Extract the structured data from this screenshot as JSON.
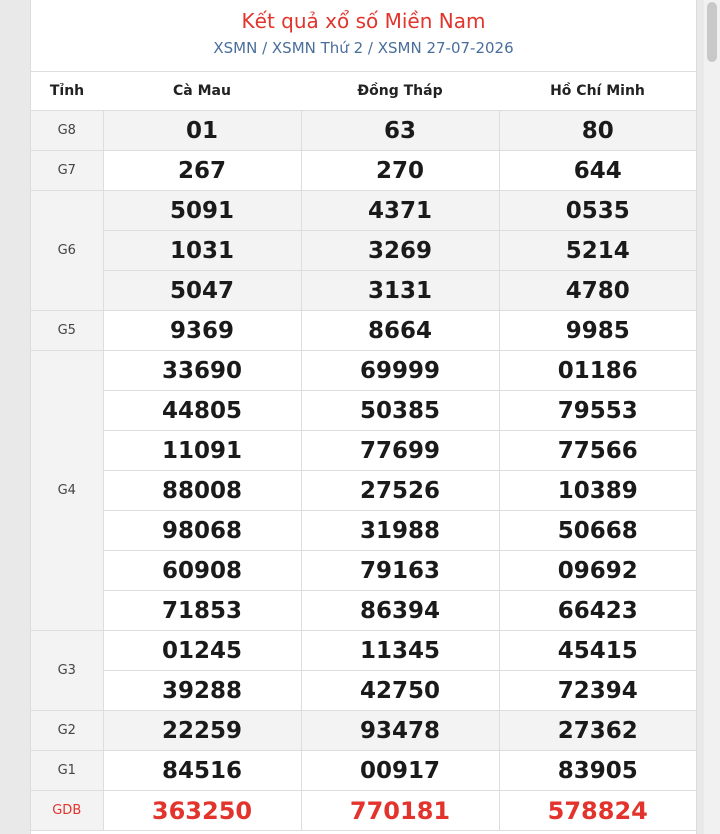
{
  "header": {
    "title": "Kết quả xổ số Miền Nam",
    "subtitle": "XSMN / XSMN Thứ 2 / XSMN 27-07-2026"
  },
  "table": {
    "columns": [
      "Tỉnh",
      "Cà Mau",
      "Đồng Tháp",
      "Hồ Chí Minh"
    ],
    "prizes": [
      {
        "label": "G8",
        "rows": [
          [
            "01",
            "63",
            "80"
          ]
        ]
      },
      {
        "label": "G7",
        "rows": [
          [
            "267",
            "270",
            "644"
          ]
        ]
      },
      {
        "label": "G6",
        "rows": [
          [
            "5091",
            "4371",
            "0535"
          ],
          [
            "1031",
            "3269",
            "5214"
          ],
          [
            "5047",
            "3131",
            "4780"
          ]
        ]
      },
      {
        "label": "G5",
        "rows": [
          [
            "9369",
            "8664",
            "9985"
          ]
        ]
      },
      {
        "label": "G4",
        "rows": [
          [
            "33690",
            "69999",
            "01186"
          ],
          [
            "44805",
            "50385",
            "79553"
          ],
          [
            "11091",
            "77699",
            "77566"
          ],
          [
            "88008",
            "27526",
            "10389"
          ],
          [
            "98068",
            "31988",
            "50668"
          ],
          [
            "60908",
            "79163",
            "09692"
          ],
          [
            "71853",
            "86394",
            "66423"
          ]
        ]
      },
      {
        "label": "G3",
        "rows": [
          [
            "01245",
            "11345",
            "45415"
          ],
          [
            "39288",
            "42750",
            "72394"
          ]
        ]
      },
      {
        "label": "G2",
        "rows": [
          [
            "22259",
            "93478",
            "27362"
          ]
        ]
      },
      {
        "label": "G1",
        "rows": [
          [
            "84516",
            "00917",
            "83905"
          ]
        ]
      },
      {
        "label": "GDB",
        "rows": [
          [
            "363250",
            "770181",
            "578824"
          ]
        ]
      }
    ]
  },
  "colors": {
    "accent_red": "#e2342c",
    "subtitle_blue": "#4a6e9a",
    "row_shade": "#f3f3f3"
  }
}
